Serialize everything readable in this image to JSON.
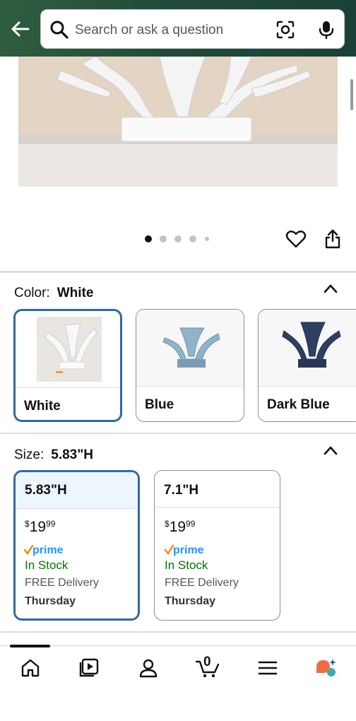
{
  "header": {
    "back_icon": "arrow-left-icon",
    "search": {
      "placeholder": "Search or ask a question",
      "camera_icon": "camera-lens-icon",
      "mic_icon": "microphone-icon"
    }
  },
  "gallery": {
    "dots_total": 5,
    "active_dot": 1,
    "wishlist_icon": "heart-icon",
    "share_icon": "share-icon"
  },
  "color": {
    "label": "Color:",
    "selected": "White",
    "options": [
      {
        "name": "White"
      },
      {
        "name": "Blue"
      },
      {
        "name": "Dark Blue"
      }
    ]
  },
  "size": {
    "label": "Size:",
    "selected": "5.83\"H",
    "options": [
      {
        "title": "5.83\"H",
        "currency": "$",
        "price_whole": "19",
        "price_fraction": "99",
        "prime": "prime",
        "stock": "In Stock",
        "delivery": "FREE Delivery",
        "day": "Thursday"
      },
      {
        "title": "7.1\"H",
        "currency": "$",
        "price_whole": "19",
        "price_fraction": "99",
        "prime": "prime",
        "stock": "In Stock",
        "delivery": "FREE Delivery",
        "day": "Thursday"
      }
    ]
  },
  "bottom_nav": {
    "items": [
      "home-icon",
      "video-icon",
      "account-icon",
      "cart-icon",
      "menu-icon",
      "rufus-assistant-icon"
    ],
    "cart_count": "0"
  },
  "colors": {
    "header_green": "#214a3a",
    "selected_border": "#2e6aa6",
    "in_stock": "#007600",
    "prime_blue": "#1a98ff"
  }
}
